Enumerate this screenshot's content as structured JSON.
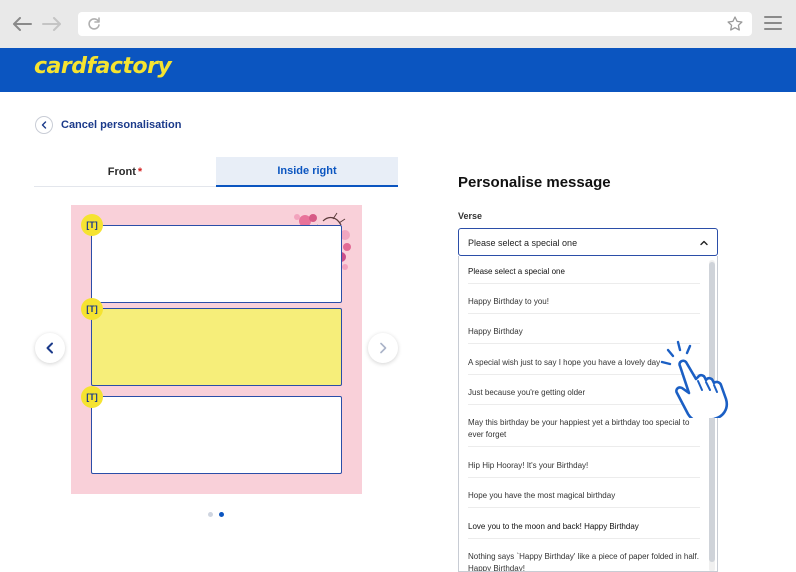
{
  "brand": {
    "logo": "cardfactory",
    "header_color": "#0b55c0",
    "logo_color": "#f5e331"
  },
  "browser": {
    "icons": [
      "back-arrow-icon",
      "forward-arrow-icon",
      "reload-icon",
      "star-icon",
      "menu-icon"
    ]
  },
  "nav": {
    "cancel_label": "Cancel personalisation"
  },
  "tabs": {
    "front": "Front",
    "front_required": "*",
    "inside_right": "Inside right",
    "active": "inside_right"
  },
  "card": {
    "textbox_badge": "[T]",
    "slides": 2,
    "active_slide": 2,
    "highlight_color": "#f6ee7a"
  },
  "panel": {
    "title": "Personalise message",
    "verse_label": "Verse",
    "selected": "Please select a special one"
  },
  "verse_options": [
    "Please select a special one",
    "Happy Birthday to you!",
    "Happy Birthday",
    "A special wish just to say I hope you have a lovely day",
    "Just because you're getting older",
    "May this birthday be your happiest yet a birthday too special to ever forget",
    "Hip Hip Hooray! It's your Birthday!",
    "Hope you have the most magical birthday",
    "Love you to the moon and back! Happy Birthday",
    "Nothing says `Happy Birthday' like a piece of paper folded in half. Happy Birthday!"
  ]
}
